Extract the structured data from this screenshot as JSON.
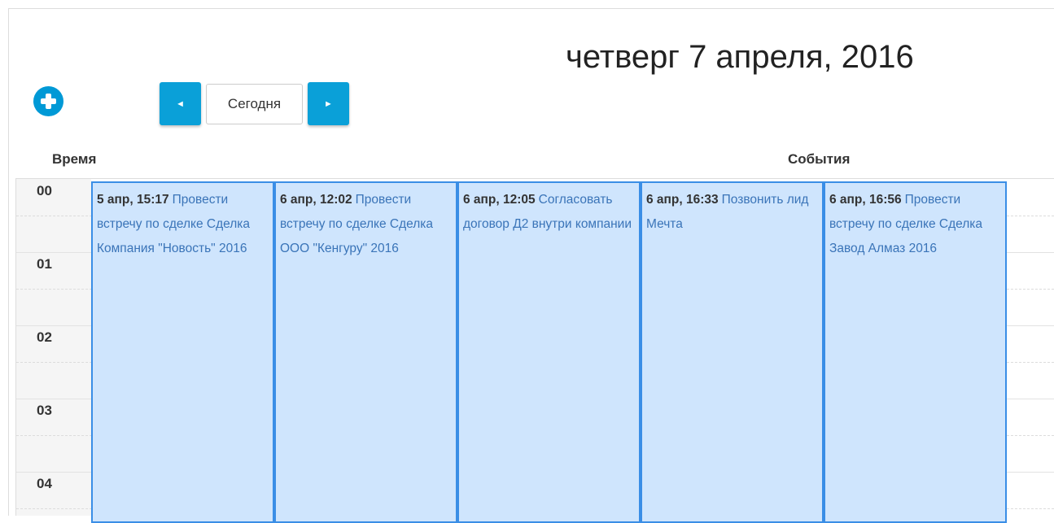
{
  "header": {
    "date_title": "четверг 7 апреля, 2016"
  },
  "toolbar": {
    "prev_label": "◄",
    "today_label": "Сегодня",
    "next_label": "►"
  },
  "columns": {
    "time_label": "Время",
    "events_label": "События"
  },
  "hours": [
    "00",
    "01",
    "02",
    "03",
    "04"
  ],
  "events": [
    {
      "time": "5 апр, 15:17",
      "title": "Провести встречу по сделке Сделка Компания \"Новость\" 2016"
    },
    {
      "time": "6 апр, 12:02",
      "title": "Провести встречу по сделке Сделка ООО \"Кенгуру\" 2016"
    },
    {
      "time": "6 апр, 12:05",
      "title": "Согласовать договор Д2 внутри компании"
    },
    {
      "time": "6 апр, 16:33",
      "title": "Позвонить лид Мечта"
    },
    {
      "time": "6 апр, 16:56",
      "title": "Провести встречу по сделке Сделка Завод Алмаз 2016"
    }
  ],
  "colors": {
    "accent": "#0aa0d8",
    "event_bg": "#cfe5fd",
    "event_border": "#3a8ee6",
    "event_link": "#3a74b8"
  },
  "icons": {
    "add": "plus-circle-icon",
    "prev": "caret-left-icon",
    "next": "caret-right-icon"
  }
}
